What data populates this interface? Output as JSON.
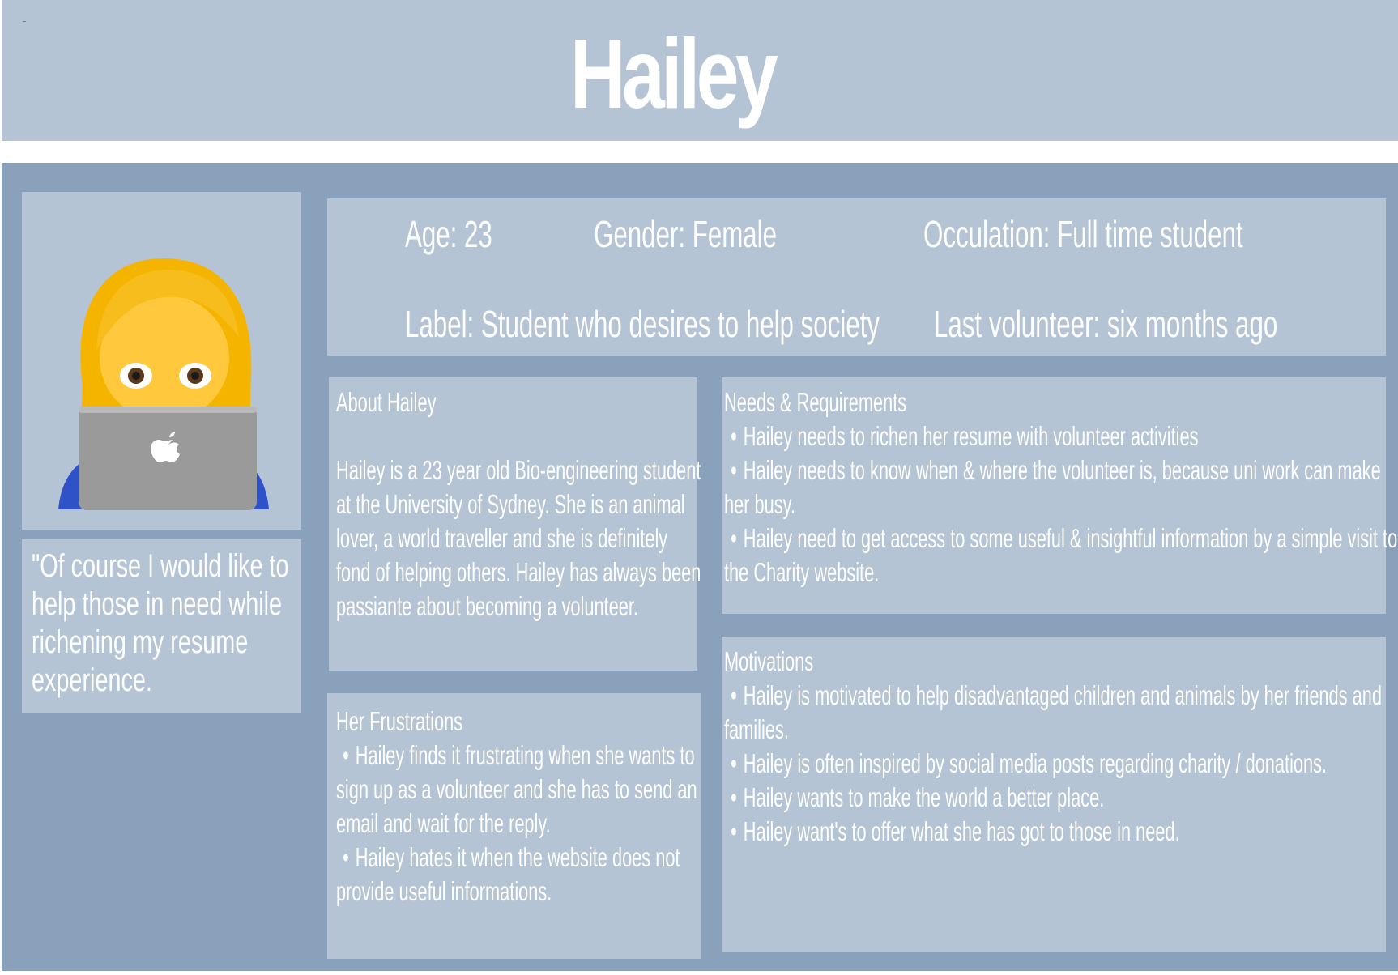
{
  "persona": {
    "name": "Hailey"
  },
  "stats": {
    "age": "Age: 23",
    "gender": "Gender: Female",
    "occupation": "Occulation: Full time student",
    "label": "Label: Student who desires to help society",
    "last_volunteer": "Last volunteer: six months ago"
  },
  "quote": "\"Of course I would like to help those in need while richening my resume experience.",
  "about": {
    "heading": "About Hailey",
    "text": "Hailey is a 23 year old Bio-engineering student at the University of Sydney. She is an animal lover, a world traveller and she is definitely fond of helping others. Hailey has always been passiante about becoming a volunteer."
  },
  "frustrations": {
    "heading": "Her Frustrations",
    "items": [
      "Hailey finds it frustrating when she wants to sign up as a volunteer and she has to send an email and wait for the reply.",
      "Hailey hates it when the website does not provide useful informations."
    ]
  },
  "needs": {
    "heading": "Needs & Requirements",
    "items": [
      "Hailey needs to richen her resume with volunteer activities",
      "Hailey needs to know when & where the volunteer is, because uni work can make her busy.",
      "Hailey need to get access to some useful & insightful information by a simple visit to the Charity website."
    ]
  },
  "motivations": {
    "heading": "Motivations",
    "items": [
      "Hailey is motivated to help disadvantaged children and animals by her friends and families.",
      "Hailey is often inspired by social media posts regarding charity / donations.",
      "Hailey wants to make the world a better place.",
      "Hailey want's to offer what she has got to those in need."
    ]
  },
  "bullet_glyph": "•",
  "icons": {
    "avatar": "woman-technologist-icon",
    "laptop_logo": "apple-logo-icon"
  },
  "colors": {
    "header_bg": "#b5c4d4",
    "main_bg": "#8aa1bb",
    "panel_bg": "#b5c4d4",
    "text": "#ffffff"
  }
}
